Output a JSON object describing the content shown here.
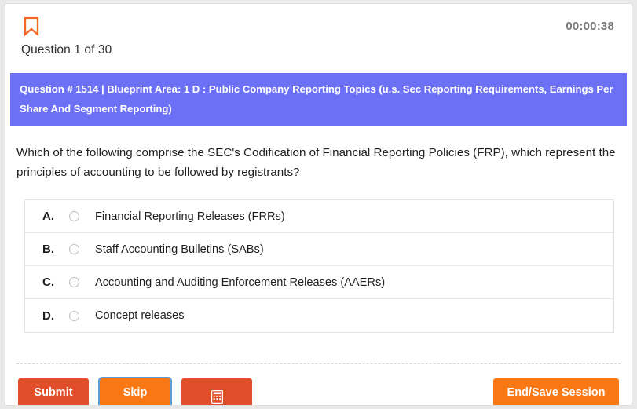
{
  "header": {
    "bookmark_icon": "bookmark-icon",
    "question_counter": "Question 1 of 30",
    "timer": "00:00:38"
  },
  "banner": {
    "text": "Question # 1514 | Blueprint Area: 1 D : Public Company Reporting Topics (u.s. Sec Reporting Requirements, Earnings Per Share And Segment Reporting)",
    "color": "#6c70f5"
  },
  "question": {
    "text": "Which of the following comprise the SEC's Codification of Financial Reporting Policies (FRP), which represent the principles of accounting to be followed by registrants?"
  },
  "options": [
    {
      "letter": "A.",
      "text": "Financial Reporting Releases (FRRs)",
      "selected": false
    },
    {
      "letter": "B.",
      "text": "Staff Accounting Bulletins (SABs)",
      "selected": false
    },
    {
      "letter": "C.",
      "text": "Accounting and Auditing Enforcement Releases (AAERs)",
      "selected": false
    },
    {
      "letter": "D.",
      "text": "Concept releases",
      "selected": false
    }
  ],
  "footer": {
    "submit_label": "Submit",
    "skip_label": "Skip",
    "calculator_icon": "calculator-icon",
    "end_session_label": "End/Save Session",
    "submit_color": "#e04e2a",
    "skip_color": "#fa7814",
    "end_session_color": "#fa7814",
    "focus_ring_color": "#5b9bd5"
  }
}
